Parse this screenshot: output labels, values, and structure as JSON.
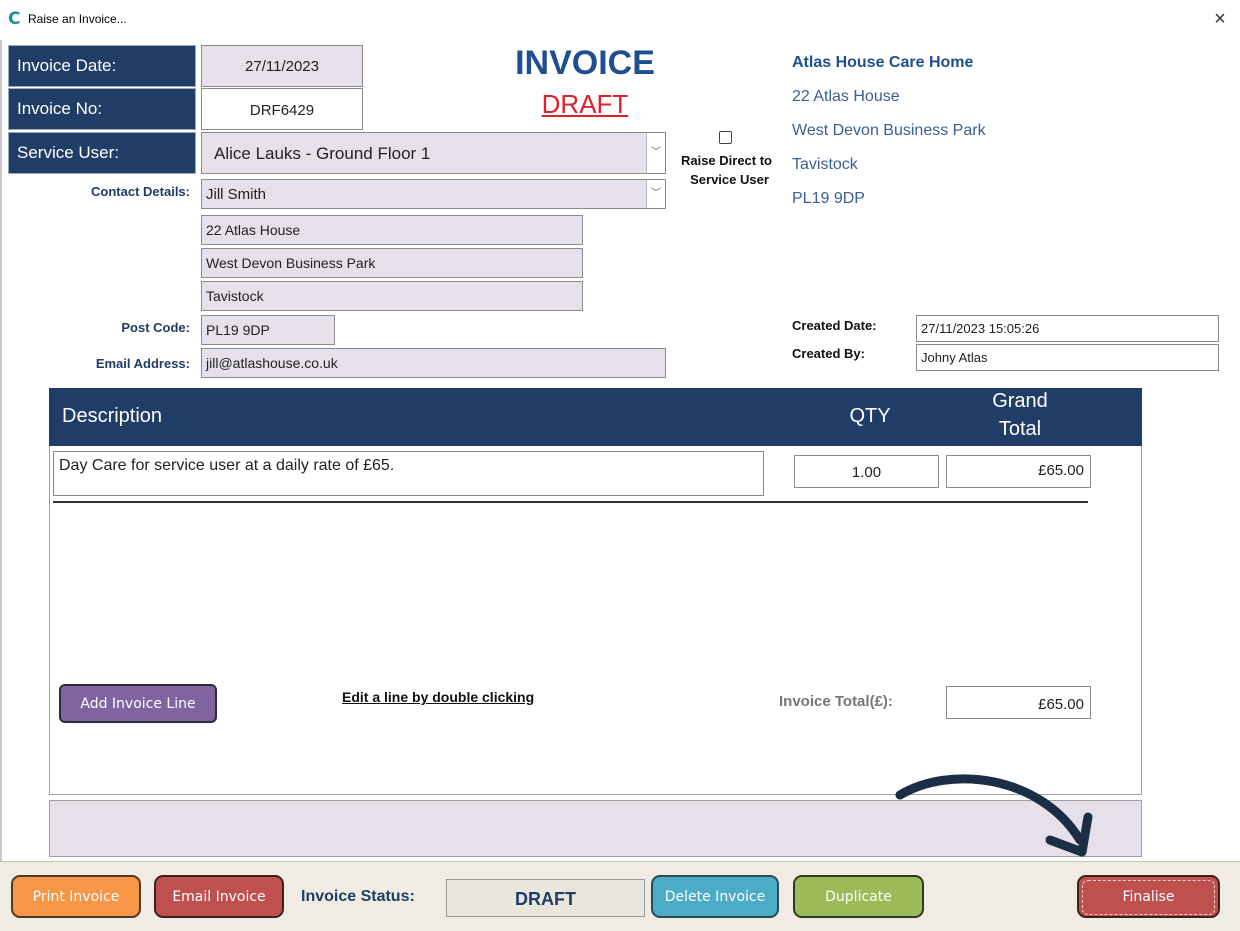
{
  "window": {
    "title": "Raise an Invoice...",
    "close_glyph": "×"
  },
  "header": {
    "invoice_date_label": "Invoice Date:",
    "invoice_date": "27/11/2023",
    "invoice_no_label": "Invoice No:",
    "invoice_no": "DRF6429",
    "service_user_label": "Service User:",
    "service_user": "Alice Lauks - Ground Floor 1",
    "title": "INVOICE",
    "status_word": "DRAFT",
    "raise_direct_label_1": "Raise Direct to",
    "raise_direct_label_2": "Service User",
    "raise_direct_checked": false
  },
  "company": {
    "name": "Atlas House Care Home",
    "line1": "22 Atlas House",
    "line2": "West Devon Business Park",
    "line3": "Tavistock",
    "postcode": "PL19 9DP"
  },
  "contact": {
    "label": "Contact Details:",
    "name": "Jill Smith",
    "address1": "22 Atlas House",
    "address2": "West Devon Business Park",
    "address3": "Tavistock",
    "postcode_label": "Post Code:",
    "postcode": "PL19 9DP",
    "email_label": "Email Address:",
    "email": "jill@atlashouse.co.uk"
  },
  "meta": {
    "created_date_label": "Created Date:",
    "created_date": "27/11/2023 15:05:26",
    "created_by_label": "Created By:",
    "created_by": "Johny Atlas"
  },
  "lines": {
    "col_description": "Description",
    "col_qty": "QTY",
    "col_total_1": "Grand",
    "col_total_2": "Total",
    "items": [
      {
        "description": "Day Care for service user at a daily rate of £65.",
        "qty": "1.00",
        "total": "£65.00"
      }
    ],
    "add_line_button": "Add Invoice Line",
    "edit_hint": "Edit a line by double clicking",
    "invoice_total_label": "Invoice Total(£):",
    "invoice_total": "£65.00"
  },
  "footer": {
    "print_button": "Print Invoice",
    "email_button": "Email Invoice",
    "status_label": "Invoice Status:",
    "status_value": "DRAFT",
    "delete_button": "Delete Invoice",
    "duplicate_button": "Duplicate",
    "finalise_button": "Finalise"
  },
  "colors": {
    "navy": "#1f3d66",
    "draft_red": "#e0202a",
    "field_grey": "#e6e0ea",
    "print_orange": "#f79646",
    "email_red": "#c0504d",
    "delete_cyan": "#4bacc6",
    "duplicate_green": "#9bbb59",
    "finalise_red": "#c0504d",
    "add_line_purple": "#8064a2"
  }
}
